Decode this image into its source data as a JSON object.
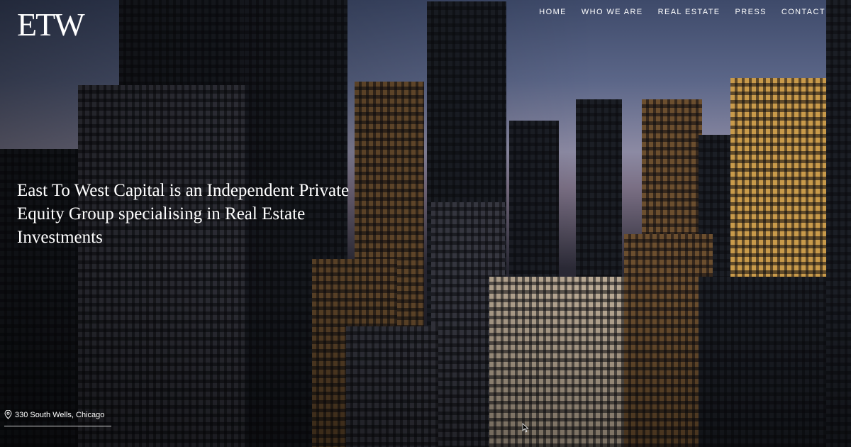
{
  "header": {
    "logo_text": "ETW",
    "nav": [
      {
        "label": "HOME"
      },
      {
        "label": "WHO WE ARE"
      },
      {
        "label": "REAL ESTATE"
      },
      {
        "label": "PRESS"
      },
      {
        "label": "CONTACT"
      }
    ]
  },
  "hero": {
    "tagline": "East To West Capital is an Independent Private Equity Group specialising in Real Estate Investments",
    "location": {
      "icon": "map-pin-icon",
      "label": "330 South Wells, Chicago"
    }
  }
}
